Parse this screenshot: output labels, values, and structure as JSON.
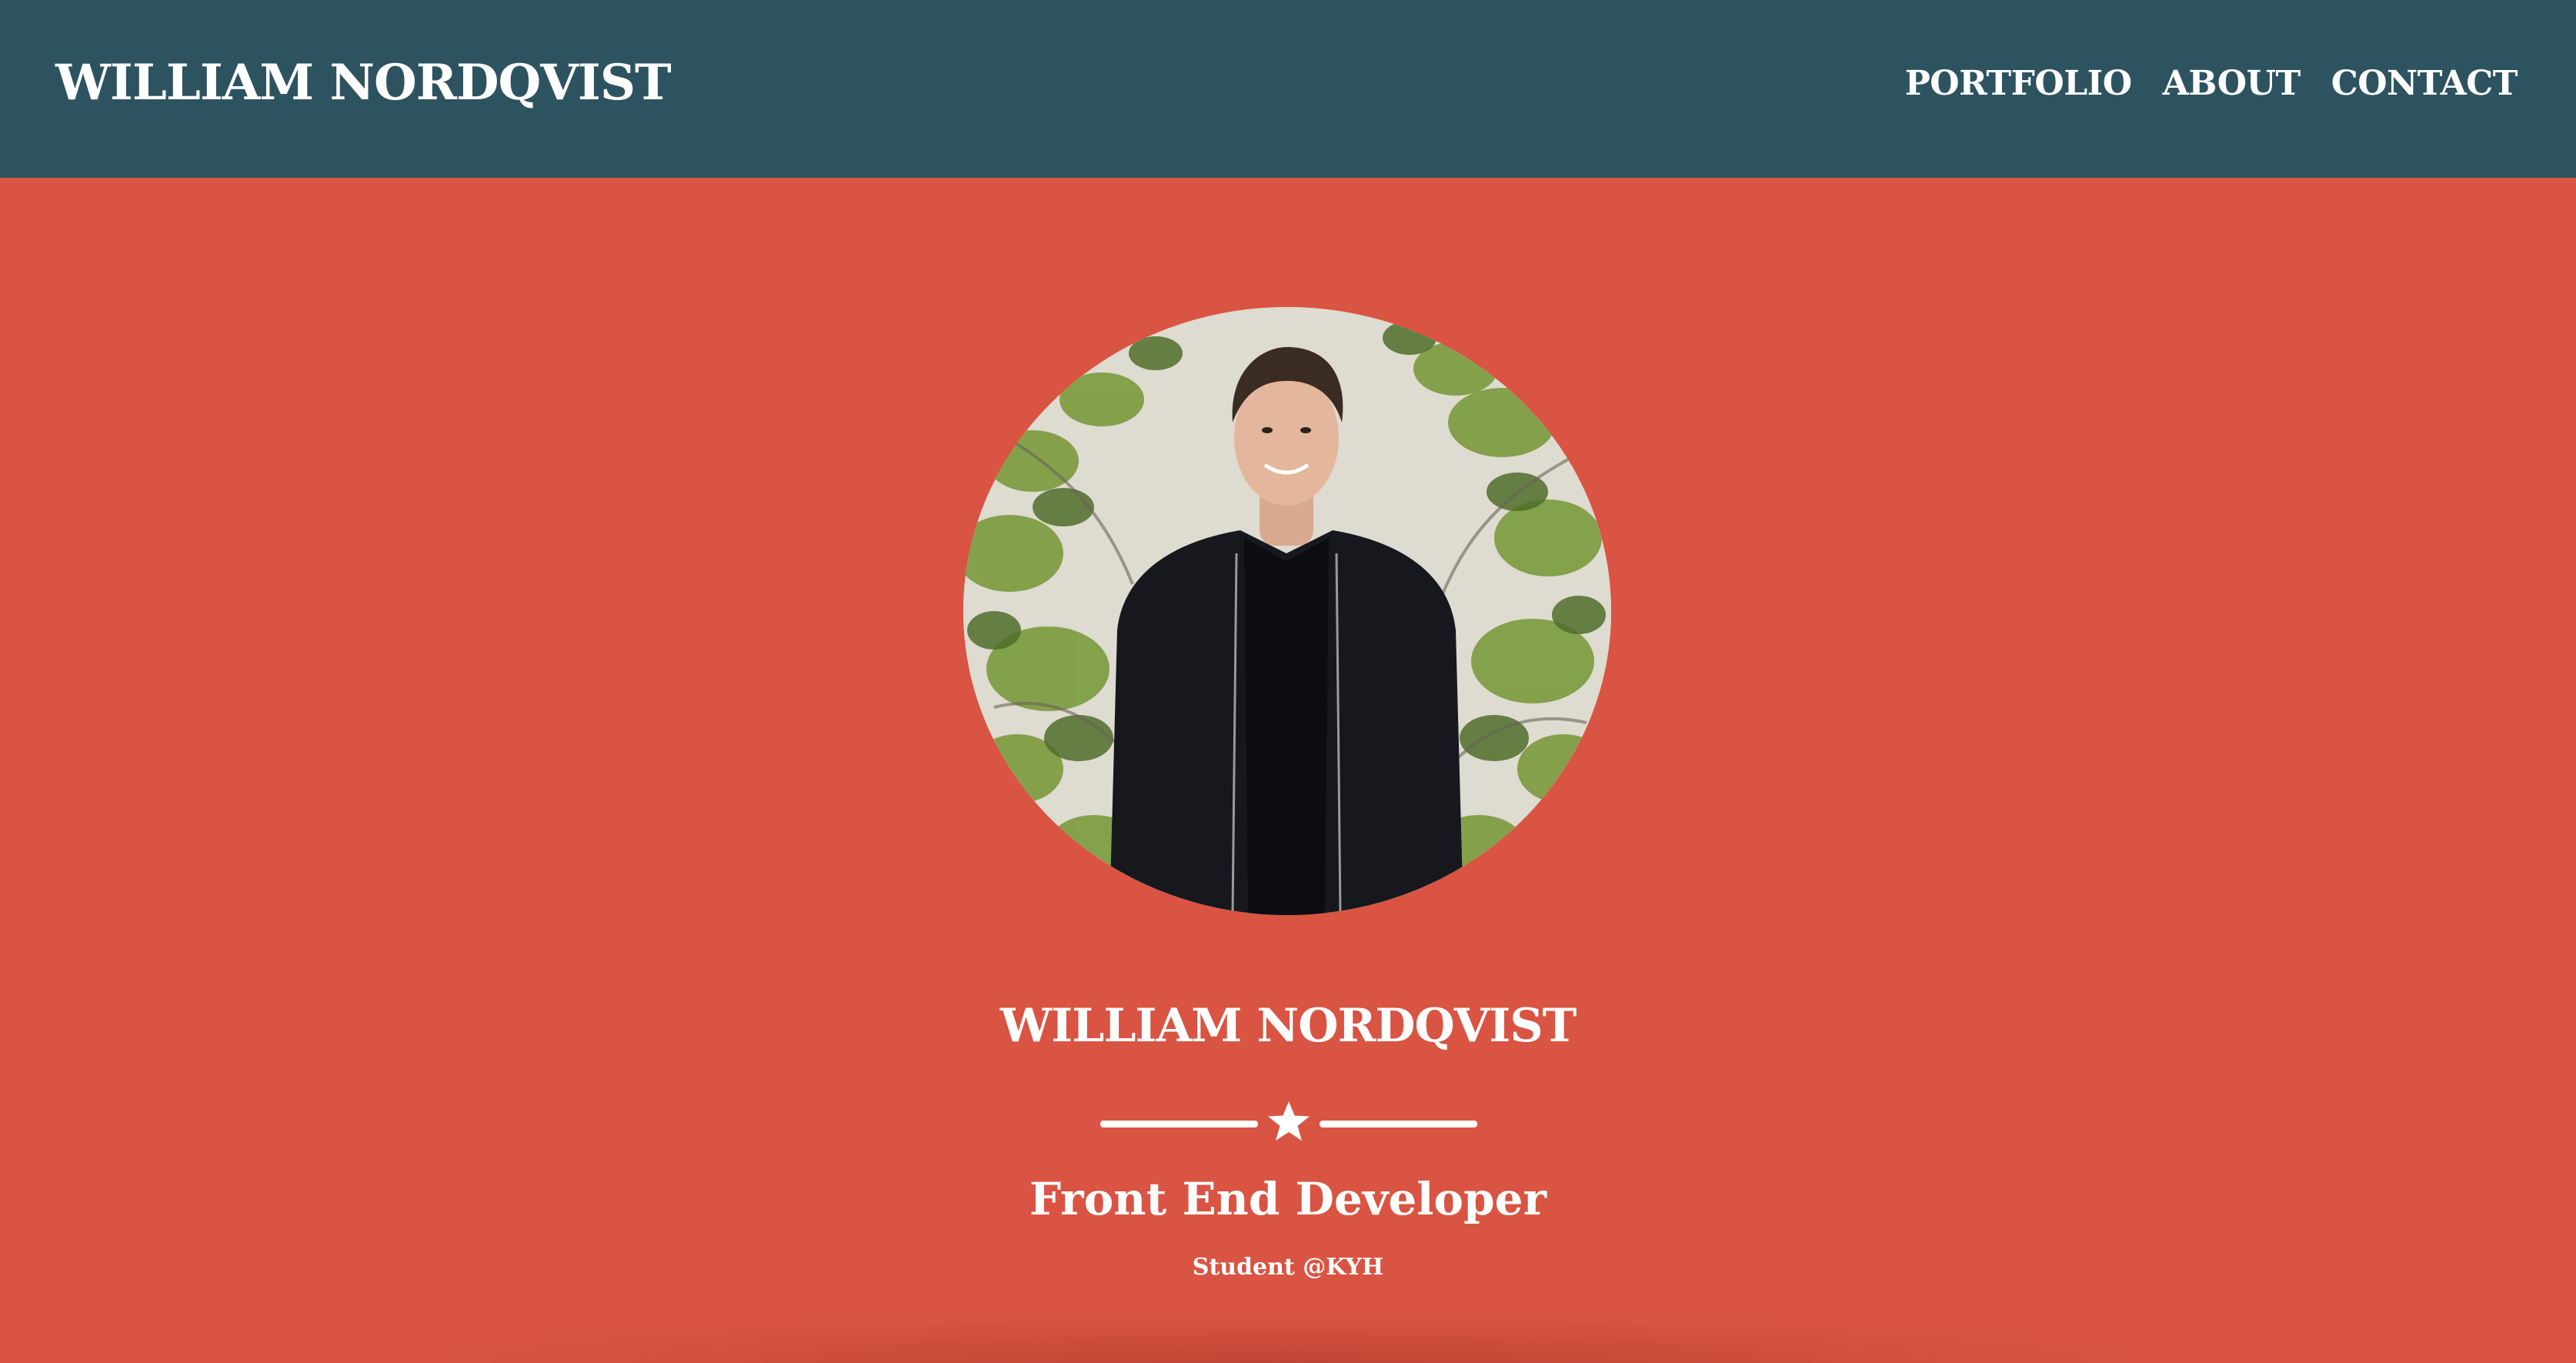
{
  "navbar": {
    "brand": "WILLIAM NORDQVIST",
    "links": [
      {
        "label": "PORTFOLIO"
      },
      {
        "label": "ABOUT"
      },
      {
        "label": "CONTACT"
      }
    ]
  },
  "hero": {
    "name": "WILLIAM NORDQVIST",
    "divider_icon": "star-icon",
    "role": "Front End Developer",
    "subtitle": "Student @KYH"
  },
  "colors": {
    "navbar_bg": "#2d5360",
    "hero_bg": "#d95442",
    "text": "#ffffff"
  }
}
